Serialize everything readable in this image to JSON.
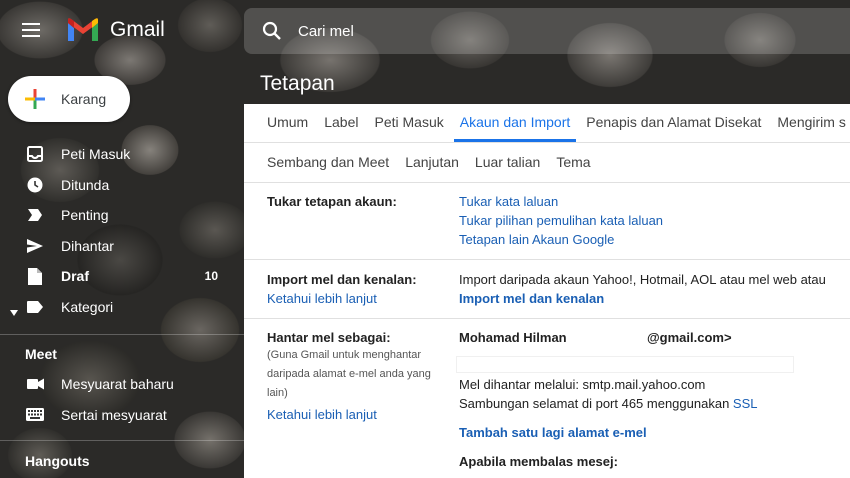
{
  "app": {
    "name": "Gmail"
  },
  "search": {
    "placeholder": "Cari mel"
  },
  "compose": {
    "label": "Karang"
  },
  "sidebar": {
    "items": [
      {
        "label": "Peti Masuk",
        "icon": "inbox-icon"
      },
      {
        "label": "Ditunda",
        "icon": "clock-icon"
      },
      {
        "label": "Penting",
        "icon": "important-icon"
      },
      {
        "label": "Dihantar",
        "icon": "send-icon"
      },
      {
        "label": "Draf",
        "icon": "draft-icon",
        "count": "10"
      },
      {
        "label": "Kategori",
        "icon": "label-icon"
      }
    ],
    "meet_title": "Meet",
    "meet_items": [
      {
        "label": "Mesyuarat baharu",
        "icon": "video-icon"
      },
      {
        "label": "Sertai mesyuarat",
        "icon": "keyboard-icon"
      }
    ],
    "hangouts_title": "Hangouts"
  },
  "page": {
    "title": "Tetapan"
  },
  "tabs_row1": [
    "Umum",
    "Label",
    "Peti Masuk",
    "Akaun dan Import",
    "Penapis dan Alamat Disekat",
    "Mengirim s"
  ],
  "tabs_row2": [
    "Sembang dan Meet",
    "Lanjutan",
    "Luar talian",
    "Tema"
  ],
  "active_tab": "Akaun dan Import",
  "sections": {
    "change_account": {
      "label": "Tukar tetapan akaun:",
      "links": [
        "Tukar kata laluan",
        "Tukar pilihan pemulihan kata laluan",
        "Tetapan lain Akaun Google"
      ]
    },
    "import": {
      "label": "Import mel dan kenalan:",
      "learn_more": "Ketahui lebih lanjut",
      "desc": "Import daripada akaun Yahoo!, Hotmail, AOL atau mel web atau",
      "action": "Import mel dan kenalan"
    },
    "send_as": {
      "label": "Hantar mel sebagai:",
      "sub": "(Guna Gmail untuk menghantar daripada alamat e-mel anda yang lain)",
      "learn_more": "Ketahui lebih lanjut",
      "name": "Mohamad Hilman",
      "email_suffix": "@gmail.com>",
      "via": "Mel dihantar melalui: smtp.mail.yahoo.com",
      "secure_prefix": "Sambungan selamat di port 465 menggunakan",
      "secure_link": "SSL",
      "add_address": "Tambah satu lagi alamat e-mel",
      "reply_label": "Apabila membalas mesej:"
    }
  }
}
